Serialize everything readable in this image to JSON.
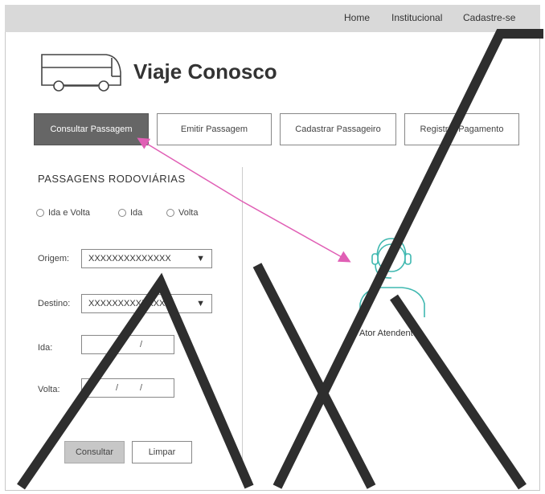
{
  "topnav": {
    "home": "Home",
    "institucional": "Institucional",
    "cadastre": "Cadastre-se"
  },
  "brand": {
    "title": "Viaje Conosco",
    "logo_icon": "bus-icon"
  },
  "tabs": [
    {
      "label": "Consultar Passagem",
      "active": true
    },
    {
      "label": "Emitir Passagem",
      "active": false
    },
    {
      "label": "Cadastrar Passageiro",
      "active": false
    },
    {
      "label": "Registrar Pagamento",
      "active": false
    }
  ],
  "form": {
    "title": "PASSAGENS RODOVIÁRIAS",
    "trip_options": [
      "Ida e Volta",
      "Ida",
      "Volta"
    ],
    "origem": {
      "label": "Origem:",
      "value": "XXXXXXXXXXXXXX",
      "caret": "▼"
    },
    "destino": {
      "label": "Destino:",
      "value": "XXXXXXXXXXXXXX",
      "caret": "▼"
    },
    "ida": {
      "label": "Ida:",
      "separator": "/"
    },
    "volta": {
      "label": "Volta:",
      "separator": "/"
    },
    "consultar_label": "Consultar",
    "limpar_label": "Limpar"
  },
  "actor": {
    "label": "Ator Atendente",
    "icon": "headset-user-icon",
    "color": "#3fb8b0"
  },
  "colors": {
    "arrow": "#e05fb5",
    "active_tab": "#666666",
    "topbar": "#d9d9d9"
  }
}
